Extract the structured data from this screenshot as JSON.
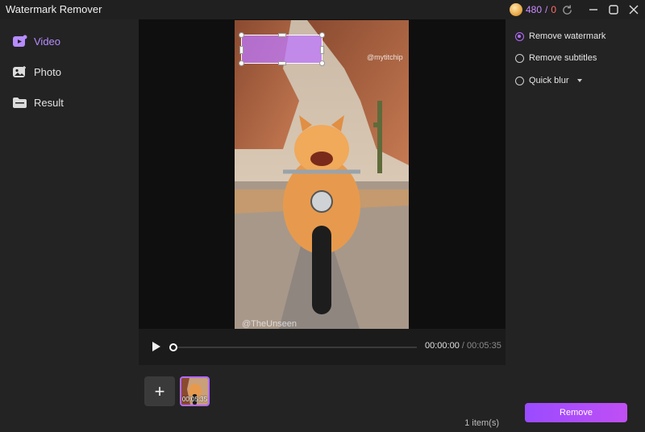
{
  "window": {
    "title": "Watermark Remover",
    "credits": {
      "value": "480",
      "separator": "/",
      "second": "0"
    }
  },
  "sidebar": {
    "items": [
      {
        "label": "Video",
        "icon": "video-icon",
        "active": true
      },
      {
        "label": "Photo",
        "icon": "photo-icon",
        "active": false
      },
      {
        "label": "Result",
        "icon": "folder-icon",
        "active": false
      }
    ]
  },
  "player": {
    "current_time": "00:00:00",
    "separator": "/",
    "duration": "00:05:35",
    "progress": 0.0,
    "corner_watermark": "@mytitchip",
    "bottom_watermark": "@TheUnseen"
  },
  "clips": {
    "add_symbol": "+",
    "items": [
      {
        "duration": "00:05:35",
        "selected": true
      }
    ],
    "count_label": "1 item(s)"
  },
  "options": {
    "items": [
      {
        "label": "Remove watermark",
        "selected": true,
        "dropdown": false
      },
      {
        "label": "Remove subtitles",
        "selected": false,
        "dropdown": false
      },
      {
        "label": "Quick blur",
        "selected": false,
        "dropdown": true
      }
    ],
    "remove_label": "Remove"
  },
  "colors": {
    "accent": "#b46cff",
    "button_gradient_start": "#9a4bff",
    "button_gradient_end": "#c04ff5"
  }
}
